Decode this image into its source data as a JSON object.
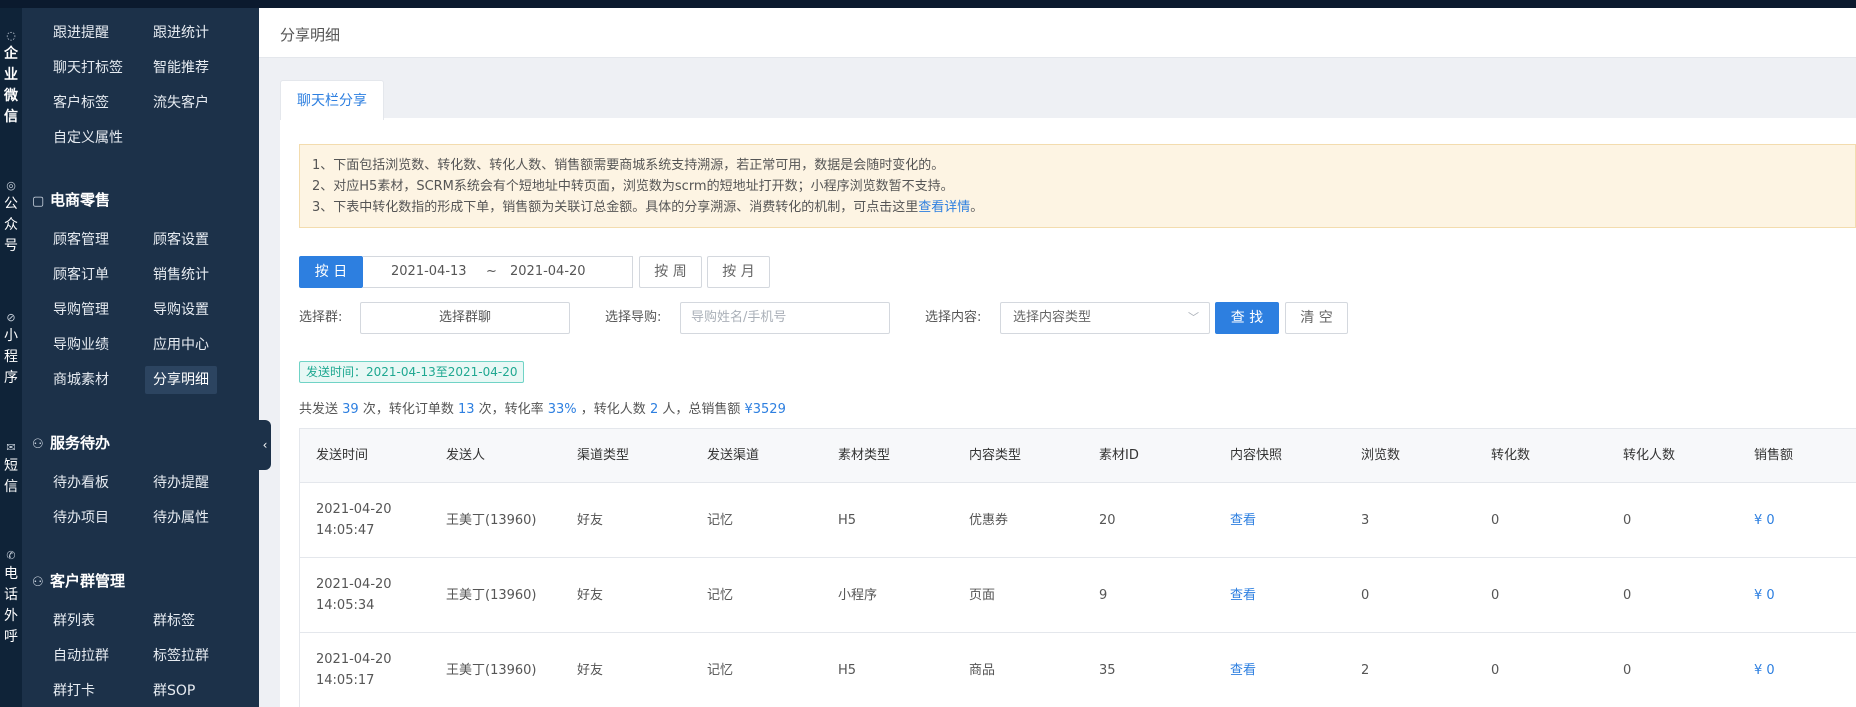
{
  "rail": [
    {
      "icon": "chat-bubble-icon",
      "glyph": "◌",
      "label": [
        "企",
        "业",
        "微",
        "信"
      ],
      "bold": true
    },
    {
      "icon": "wechat-icon",
      "glyph": "◎",
      "label": [
        "公",
        "众",
        "号"
      ],
      "bold": false
    },
    {
      "icon": "mini-program-icon",
      "glyph": "⊘",
      "label": [
        "小",
        "程",
        "序"
      ],
      "bold": false
    },
    {
      "icon": "mail-icon",
      "glyph": "✉",
      "label": [
        "短",
        "信"
      ],
      "bold": false
    },
    {
      "icon": "phone-icon",
      "glyph": "✆",
      "label": [
        "电",
        "话",
        "外",
        "呼"
      ],
      "bold": false
    }
  ],
  "sidebar": {
    "top_items": [
      "跟进提醒",
      "跟进统计",
      "聊天打标签",
      "智能推荐",
      "客户标签",
      "流失客户",
      "自定义属性"
    ],
    "sections": [
      {
        "title": "电商零售",
        "icon": "shop-bag-icon",
        "glyph": "▢",
        "items": [
          "顾客管理",
          "顾客设置",
          "顾客订单",
          "销售统计",
          "导购管理",
          "导购设置",
          "导购业绩",
          "应用中心",
          "商城素材",
          "分享明细"
        ]
      },
      {
        "title": "服务待办",
        "icon": "service-user-icon",
        "glyph": "⚇",
        "items": [
          "待办看板",
          "待办提醒",
          "待办项目",
          "待办属性"
        ]
      },
      {
        "title": "客户群管理",
        "icon": "group-user-icon",
        "glyph": "⚇",
        "items": [
          "群列表",
          "群标签",
          "自动拉群",
          "标签拉群",
          "群打卡",
          "群SOP"
        ]
      }
    ],
    "active": "分享明细"
  },
  "page": {
    "title": "分享明细",
    "tab": "聊天栏分享"
  },
  "notice": {
    "line1": "1、下面包括浏览数、转化数、转化人数、销售额需要商城系统支持溯源，若正常可用，数据是会随时变化的。",
    "line2": "2、对应H5素材，SCRM系统会有个短地址中转页面，浏览数为scrm的短地址打开数；小程序浏览数暂不支持。",
    "line3": "3、下表中转化数指的形成下单，销售额为关联订总金额。具体的分享溯源、消费转化的机制，可点击这里",
    "link": "查看详情",
    "end": "。"
  },
  "filters": {
    "by_day": "按 日",
    "by_week": "按 周",
    "by_month": "按 月",
    "date_start": "2021-04-13",
    "date_sep": "~",
    "date_end": "2021-04-20",
    "group_label": "选择群:",
    "group_value": "选择群聊",
    "guide_label": "选择导购:",
    "guide_placeholder": "导购姓名/手机号",
    "content_label": "选择内容:",
    "content_placeholder": "选择内容类型",
    "search": "查 找",
    "clear": "清 空"
  },
  "tag": "发送时间：2021-04-13至2021-04-20",
  "summary": {
    "p1": "共发送 ",
    "sent": "39",
    "p2": " 次，转化订单数 ",
    "orders": "13",
    "p3": " 次，转化率 ",
    "rate": "33%",
    "p4": " ，转化人数 ",
    "people": "2",
    "p5": " 人，总销售额 ",
    "sales": "¥3529"
  },
  "table": {
    "columns": [
      "发送时间",
      "发送人",
      "渠道类型",
      "发送渠道",
      "素材类型",
      "内容类型",
      "素材ID",
      "内容快照",
      "浏览数",
      "转化数",
      "转化人数",
      "销售额"
    ],
    "rows": [
      [
        "2021-04-20 14:05:47",
        "王美丁(13960)",
        "好友",
        "记忆",
        "H5",
        "优惠券",
        "20",
        "查看",
        "3",
        "0",
        "0",
        "¥ 0"
      ],
      [
        "2021-04-20 14:05:34",
        "王美丁(13960)",
        "好友",
        "记忆",
        "小程序",
        "页面",
        "9",
        "查看",
        "0",
        "0",
        "0",
        "¥ 0"
      ],
      [
        "2021-04-20 14:05:17",
        "王美丁(13960)",
        "好友",
        "记忆",
        "H5",
        "商品",
        "35",
        "查看",
        "2",
        "0",
        "0",
        "¥ 0"
      ]
    ]
  }
}
